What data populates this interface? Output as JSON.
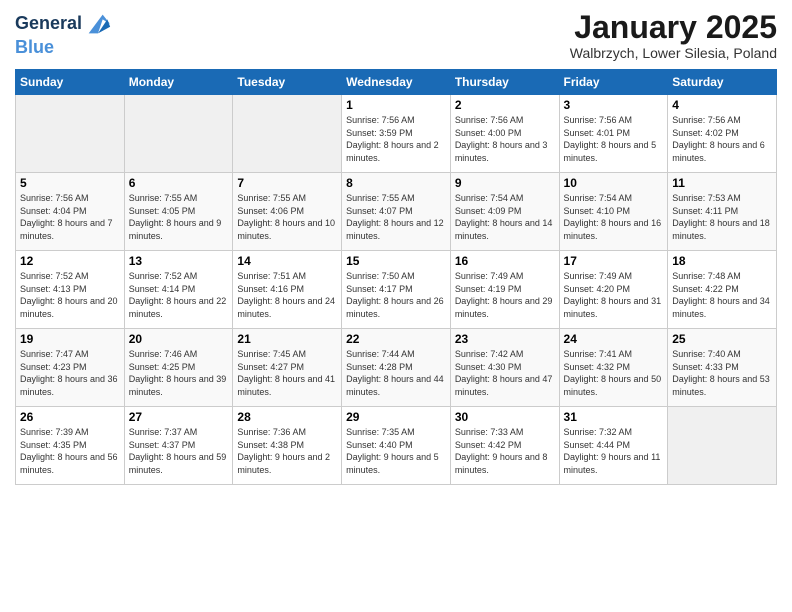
{
  "logo": {
    "line1": "General",
    "line2": "Blue"
  },
  "title": "January 2025",
  "subtitle": "Walbrzych, Lower Silesia, Poland",
  "weekdays": [
    "Sunday",
    "Monday",
    "Tuesday",
    "Wednesday",
    "Thursday",
    "Friday",
    "Saturday"
  ],
  "weeks": [
    [
      {
        "day": "",
        "info": ""
      },
      {
        "day": "",
        "info": ""
      },
      {
        "day": "",
        "info": ""
      },
      {
        "day": "1",
        "info": "Sunrise: 7:56 AM\nSunset: 3:59 PM\nDaylight: 8 hours and 2 minutes."
      },
      {
        "day": "2",
        "info": "Sunrise: 7:56 AM\nSunset: 4:00 PM\nDaylight: 8 hours and 3 minutes."
      },
      {
        "day": "3",
        "info": "Sunrise: 7:56 AM\nSunset: 4:01 PM\nDaylight: 8 hours and 5 minutes."
      },
      {
        "day": "4",
        "info": "Sunrise: 7:56 AM\nSunset: 4:02 PM\nDaylight: 8 hours and 6 minutes."
      }
    ],
    [
      {
        "day": "5",
        "info": "Sunrise: 7:56 AM\nSunset: 4:04 PM\nDaylight: 8 hours and 7 minutes."
      },
      {
        "day": "6",
        "info": "Sunrise: 7:55 AM\nSunset: 4:05 PM\nDaylight: 8 hours and 9 minutes."
      },
      {
        "day": "7",
        "info": "Sunrise: 7:55 AM\nSunset: 4:06 PM\nDaylight: 8 hours and 10 minutes."
      },
      {
        "day": "8",
        "info": "Sunrise: 7:55 AM\nSunset: 4:07 PM\nDaylight: 8 hours and 12 minutes."
      },
      {
        "day": "9",
        "info": "Sunrise: 7:54 AM\nSunset: 4:09 PM\nDaylight: 8 hours and 14 minutes."
      },
      {
        "day": "10",
        "info": "Sunrise: 7:54 AM\nSunset: 4:10 PM\nDaylight: 8 hours and 16 minutes."
      },
      {
        "day": "11",
        "info": "Sunrise: 7:53 AM\nSunset: 4:11 PM\nDaylight: 8 hours and 18 minutes."
      }
    ],
    [
      {
        "day": "12",
        "info": "Sunrise: 7:52 AM\nSunset: 4:13 PM\nDaylight: 8 hours and 20 minutes."
      },
      {
        "day": "13",
        "info": "Sunrise: 7:52 AM\nSunset: 4:14 PM\nDaylight: 8 hours and 22 minutes."
      },
      {
        "day": "14",
        "info": "Sunrise: 7:51 AM\nSunset: 4:16 PM\nDaylight: 8 hours and 24 minutes."
      },
      {
        "day": "15",
        "info": "Sunrise: 7:50 AM\nSunset: 4:17 PM\nDaylight: 8 hours and 26 minutes."
      },
      {
        "day": "16",
        "info": "Sunrise: 7:49 AM\nSunset: 4:19 PM\nDaylight: 8 hours and 29 minutes."
      },
      {
        "day": "17",
        "info": "Sunrise: 7:49 AM\nSunset: 4:20 PM\nDaylight: 8 hours and 31 minutes."
      },
      {
        "day": "18",
        "info": "Sunrise: 7:48 AM\nSunset: 4:22 PM\nDaylight: 8 hours and 34 minutes."
      }
    ],
    [
      {
        "day": "19",
        "info": "Sunrise: 7:47 AM\nSunset: 4:23 PM\nDaylight: 8 hours and 36 minutes."
      },
      {
        "day": "20",
        "info": "Sunrise: 7:46 AM\nSunset: 4:25 PM\nDaylight: 8 hours and 39 minutes."
      },
      {
        "day": "21",
        "info": "Sunrise: 7:45 AM\nSunset: 4:27 PM\nDaylight: 8 hours and 41 minutes."
      },
      {
        "day": "22",
        "info": "Sunrise: 7:44 AM\nSunset: 4:28 PM\nDaylight: 8 hours and 44 minutes."
      },
      {
        "day": "23",
        "info": "Sunrise: 7:42 AM\nSunset: 4:30 PM\nDaylight: 8 hours and 47 minutes."
      },
      {
        "day": "24",
        "info": "Sunrise: 7:41 AM\nSunset: 4:32 PM\nDaylight: 8 hours and 50 minutes."
      },
      {
        "day": "25",
        "info": "Sunrise: 7:40 AM\nSunset: 4:33 PM\nDaylight: 8 hours and 53 minutes."
      }
    ],
    [
      {
        "day": "26",
        "info": "Sunrise: 7:39 AM\nSunset: 4:35 PM\nDaylight: 8 hours and 56 minutes."
      },
      {
        "day": "27",
        "info": "Sunrise: 7:37 AM\nSunset: 4:37 PM\nDaylight: 8 hours and 59 minutes."
      },
      {
        "day": "28",
        "info": "Sunrise: 7:36 AM\nSunset: 4:38 PM\nDaylight: 9 hours and 2 minutes."
      },
      {
        "day": "29",
        "info": "Sunrise: 7:35 AM\nSunset: 4:40 PM\nDaylight: 9 hours and 5 minutes."
      },
      {
        "day": "30",
        "info": "Sunrise: 7:33 AM\nSunset: 4:42 PM\nDaylight: 9 hours and 8 minutes."
      },
      {
        "day": "31",
        "info": "Sunrise: 7:32 AM\nSunset: 4:44 PM\nDaylight: 9 hours and 11 minutes."
      },
      {
        "day": "",
        "info": ""
      }
    ]
  ]
}
